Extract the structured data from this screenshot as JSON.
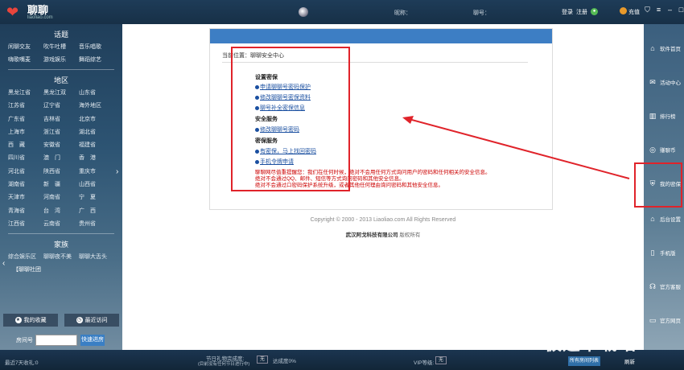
{
  "app": {
    "title": "聊聊",
    "url": "liaoliao.com",
    "nickname_label": "昵称：",
    "number_label": "聊号：",
    "login": "登录",
    "register": "注册",
    "recharge": "充值"
  },
  "left": {
    "topics_title": "话题",
    "topics": [
      "闲聊交友",
      "吹牛吐槽",
      "音乐唱歌",
      "嗨歌嘴麦",
      "游戏娱乐",
      "舞蹈综艺"
    ],
    "region_title": "地区",
    "regions": [
      "黑龙江省",
      "黑龙江双",
      "山东省",
      "江苏省",
      "辽宁省",
      "海外地区",
      "广东省",
      "吉林省",
      "北京市",
      "上海市",
      "浙江省",
      "湖北省",
      "西　藏",
      "安徽省",
      "福建省",
      "四川省",
      "澳　门",
      "香　港",
      "河北省",
      "陕西省",
      "重庆市",
      "湖南省",
      "新　疆",
      "山西省",
      "天津市",
      "河南省",
      "宁　夏",
      "青海省",
      "台　湾",
      "广　西",
      "江西省",
      "云南省",
      "贵州省"
    ],
    "clan_title": "家族",
    "clans": [
      "综合娱乐区",
      "聊聊夜不美",
      "聊聊大舌头"
    ],
    "clan_link": "【聊聊社团",
    "favorites": "我的收藏",
    "recent": "最近访问",
    "room_label": "房间号",
    "room_go": "快速进房"
  },
  "main": {
    "crumb": "当前位置：聊聊安全中心",
    "sections": [
      {
        "head": "设置密保",
        "links": [
          "申请聊聊号密码保护",
          "修改聊聊号密保资料",
          "聊号补全密保信息"
        ]
      },
      {
        "head": "安全服务",
        "links": [
          "修改聊聊号密码"
        ]
      },
      {
        "head": "密保服务",
        "links": [
          "有密保，马上找回密码",
          "手机令牌申请"
        ]
      }
    ],
    "warnings": [
      "聊聊网尽值重提醒您：我们在任何时候，绝对不会用任何方式询问用户的密码和任何相关的安全信息。",
      "绝对不会通过QQ、邮件、短信等方式询问密码和其他安全信息。",
      "绝对不会通过口密码保护系统升级，或者其他任何理由询问密码和其他安全信息。"
    ],
    "copyright": "Copyright © 2000 - 2013 Liaoliao.com All Rights Reserved",
    "company": "武汉阿戈科技有限公司",
    "company_suffix": " 版权所有"
  },
  "right": {
    "items": [
      "软件首页",
      "活动中心",
      "排行榜",
      "赚聊币",
      "我的密保",
      "后台设置",
      "手机版",
      "官方客服",
      "官方网页"
    ]
  },
  "bottom": {
    "recent_income": "最近7天收礼:0",
    "festival": "节日礼物完成度:",
    "festival_sub": "(目前没有任何节日进行中)",
    "none1": "无",
    "rate": "达成度0%",
    "vip": "VIP等级:",
    "none2": "无",
    "all_rooms": "所有房间列表",
    "refresh": "刷新",
    "watermark": "极速下载站"
  }
}
